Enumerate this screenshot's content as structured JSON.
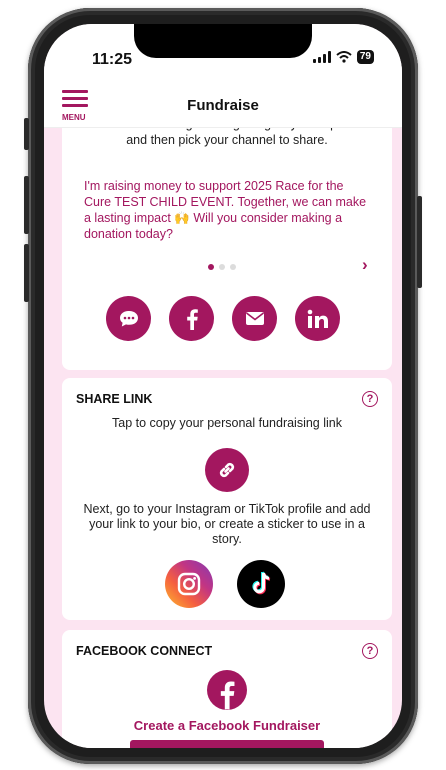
{
  "status_bar": {
    "time": "11:25",
    "battery": "79"
  },
  "nav": {
    "menu_label": "MENU",
    "title": "Fundraise"
  },
  "message_card": {
    "intro": "Select a fundraising message to give you inspiration and then pick your channel to share.",
    "message": "I'm raising money to support 2025 Race for the Cure TEST CHILD EVENT. Together, we can make a lasting impact 🙌 Will you consider making a donation today?",
    "next_arrow": "›",
    "share_icons": [
      "message-icon",
      "facebook-icon",
      "email-icon",
      "linkedin-icon"
    ]
  },
  "share_link": {
    "title": "SHARE LINK",
    "help": "?",
    "tap_text": "Tap to copy your personal fundraising link",
    "next_text": "Next, go to your Instagram or TikTok profile and add your link to your bio, or create a sticker to use in a story."
  },
  "facebook_connect": {
    "title": "FACEBOOK CONNECT",
    "help": "?",
    "link": "Create a Facebook Fundraiser"
  },
  "colors": {
    "brand": "#a3175f",
    "background": "#fce4f1"
  }
}
